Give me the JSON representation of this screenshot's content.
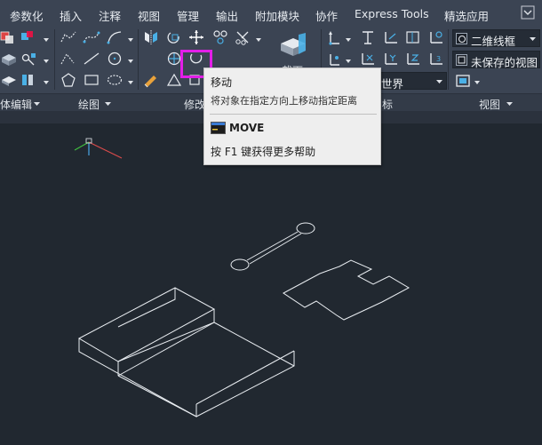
{
  "menu": {
    "tabs": [
      {
        "label": "参数化"
      },
      {
        "label": "插入"
      },
      {
        "label": "注释"
      },
      {
        "label": "视图"
      },
      {
        "label": "管理"
      },
      {
        "label": "输出"
      },
      {
        "label": "附加模块"
      },
      {
        "label": "协作"
      },
      {
        "label": "Express Tools"
      },
      {
        "label": "精选应用"
      }
    ]
  },
  "ribbon": {
    "groups": [
      {
        "label": "体编辑"
      },
      {
        "label": "绘图"
      },
      {
        "label": "修改"
      },
      {
        "label": "标"
      },
      {
        "label": "视图"
      }
    ],
    "section_label": "截面",
    "ucs_combo": {
      "value": "世界"
    },
    "visual_style_combo": {
      "value": "二维线框"
    },
    "view_combo": {
      "value": "未保存的视图"
    }
  },
  "tooltip": {
    "title": "移动",
    "description": "将对象在指定方向上移动指定距离",
    "command": "MOVE",
    "help": "按 F1 键获得更多帮助"
  },
  "colors": {
    "ribbon_bg": "#3b4453",
    "canvas_bg": "#212830",
    "highlight": "#e31ee8",
    "ucs_x": "#d94b4b",
    "ucs_y": "#3fbf3f",
    "ucs_z": "#4aa8e8"
  }
}
